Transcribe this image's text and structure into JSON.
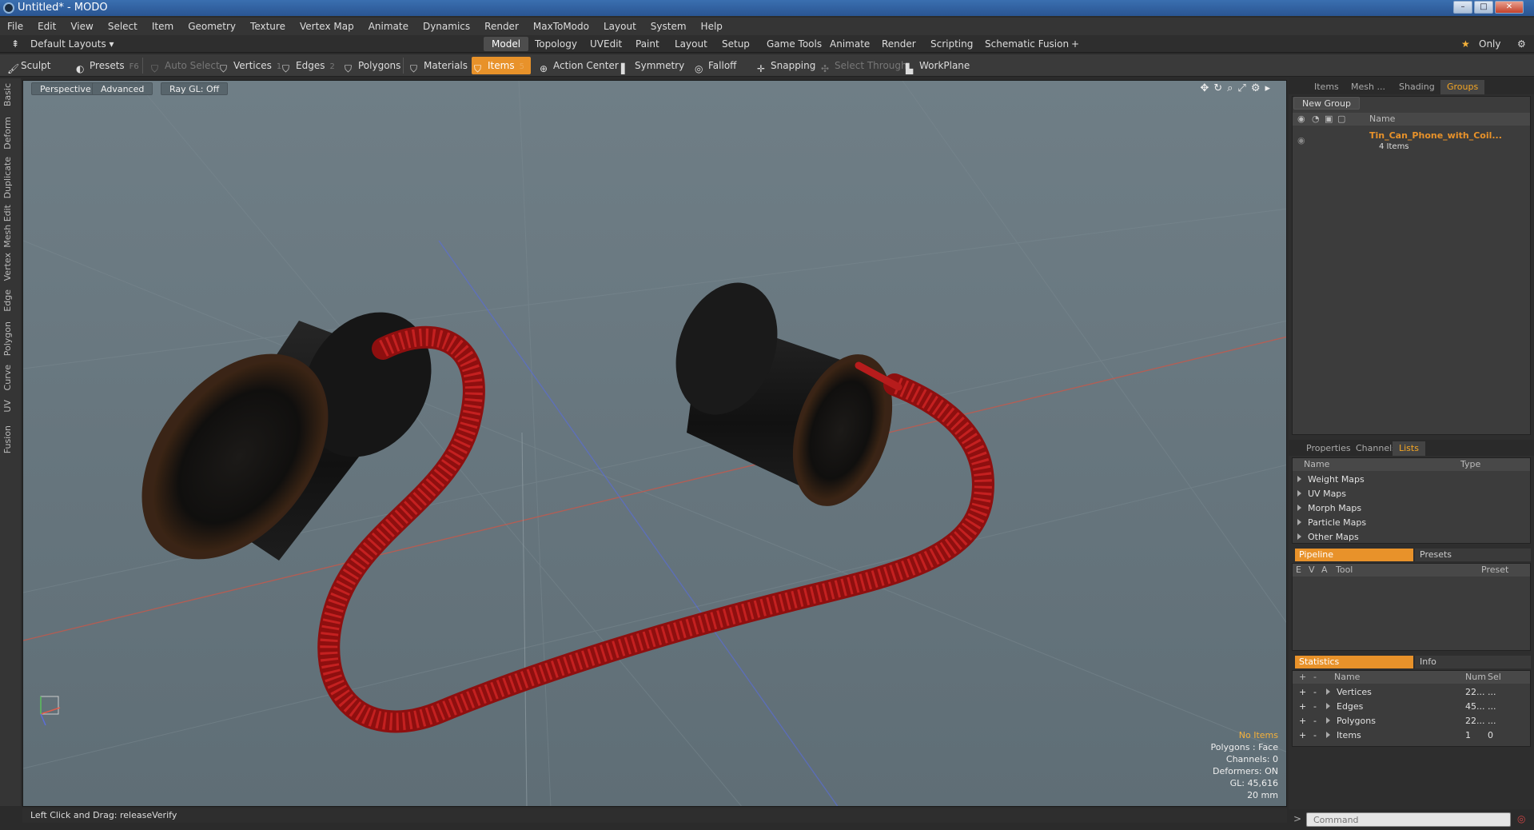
{
  "window": {
    "title": "Untitled* - MODO"
  },
  "menu": [
    "File",
    "Edit",
    "View",
    "Select",
    "Item",
    "Geometry",
    "Texture",
    "Vertex Map",
    "Animate",
    "Dynamics",
    "Render",
    "MaxToModo",
    "Layout",
    "System",
    "Help"
  ],
  "layout_selector": "Default Layouts",
  "layout_tabs": [
    "Model",
    "Topology",
    "UVEdit",
    "Paint",
    "Layout",
    "Setup",
    "Game Tools",
    "Animate",
    "Render",
    "Scripting",
    "Schematic Fusion"
  ],
  "only_label": "Only",
  "toolbar": {
    "sculpt": "Sculpt",
    "presets": "Presets",
    "presets_key": "F6",
    "auto_select": "Auto Select",
    "vertices": "Vertices",
    "vertices_key": "1",
    "edges": "Edges",
    "edges_key": "2",
    "polygons": "Polygons",
    "materials": "Materials",
    "items": "Items",
    "items_key": "5",
    "action_center": "Action Center",
    "symmetry": "Symmetry",
    "falloff": "Falloff",
    "snapping": "Snapping",
    "select_through": "Select Through",
    "workplane": "WorkPlane"
  },
  "left_tabs": [
    "Basic",
    "Deform",
    "Duplicate",
    "Mesh Edit",
    "Vertex",
    "Edge",
    "Polygon",
    "Curve",
    "UV",
    "Fusion"
  ],
  "viewport": {
    "perspective": "Perspective",
    "advanced": "Advanced",
    "raygl": "Ray GL: Off",
    "info": {
      "selection": "No Items",
      "polygons": "Polygons : Face",
      "channels": "Channels: 0",
      "deformers": "Deformers: ON",
      "gl": "GL: 45,616",
      "scale": "20 mm"
    }
  },
  "status": {
    "text": "Left Click and Drag:   releaseVerify"
  },
  "right_panel": {
    "top_tabs": [
      "Items",
      "Mesh ...",
      "Shading",
      "Groups"
    ],
    "new_group": "New Group",
    "name_header": "Name",
    "group_name": "Tin_Can_Phone_with_Coil...",
    "group_count": "4 Items",
    "mid_tabs": [
      "Properties",
      "Channels",
      "Lists"
    ],
    "lists_headers": {
      "name": "Name",
      "type": "Type"
    },
    "lists_items": [
      "Weight Maps",
      "UV Maps",
      "Morph Maps",
      "Particle Maps",
      "Other Maps"
    ],
    "pipeline_tab": "Pipeline",
    "presets_tab": "Presets",
    "pipeline_headers": {
      "e": "E",
      "v": "V",
      "a": "A",
      "tool": "Tool",
      "preset": "Preset"
    },
    "statistics_tab": "Statistics",
    "info_tab": "Info",
    "stats_headers": {
      "name": "Name",
      "num": "Num",
      "sel": "Sel"
    },
    "stats_rows": [
      {
        "name": "Vertices",
        "num": "22...",
        "sel": "..."
      },
      {
        "name": "Edges",
        "num": "45...",
        "sel": "..."
      },
      {
        "name": "Polygons",
        "num": "22...",
        "sel": "..."
      },
      {
        "name": "Items",
        "num": "1",
        "sel": "0"
      }
    ],
    "command_placeholder": "Command"
  },
  "colors": {
    "accent": "#e8922a",
    "viewport_bg": "#6a7981",
    "cord": "#a81515",
    "can": "#1a1a1a"
  }
}
